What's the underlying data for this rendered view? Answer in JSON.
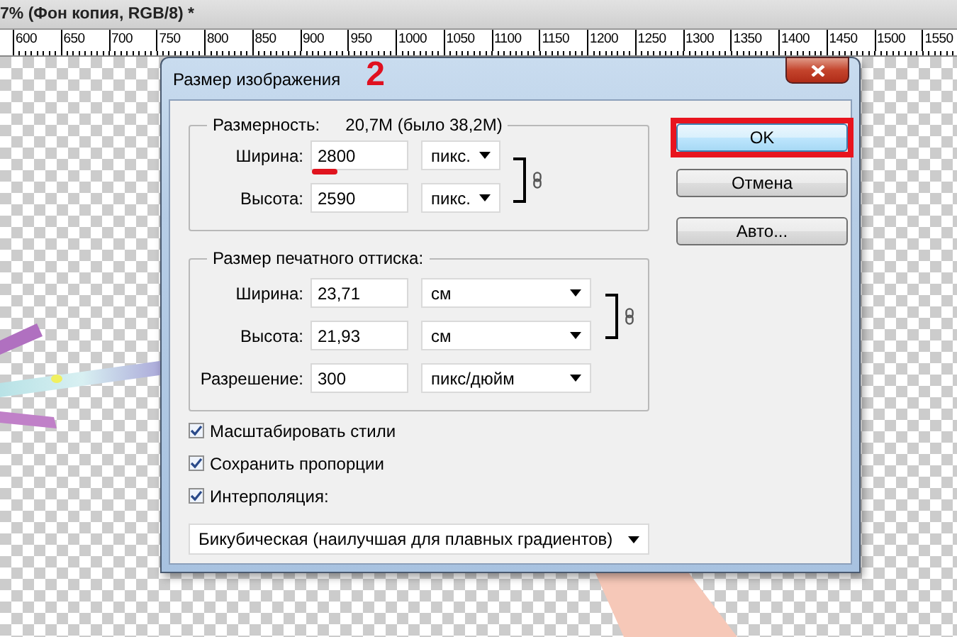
{
  "document_tab": {
    "title": "7% (Фон копия, RGB/8) *"
  },
  "ruler": {
    "labels": [
      "600",
      "650",
      "700",
      "750",
      "800",
      "850",
      "900",
      "950",
      "1000",
      "1050",
      "1100",
      "1150",
      "1200",
      "1250",
      "1300",
      "1350",
      "1400",
      "1450",
      "1500",
      "1550"
    ]
  },
  "dialog": {
    "title": "Размер изображения",
    "annotation": "2",
    "pixel_dimensions": {
      "label": "Размерность:",
      "value": "20,7M (было 38,2M)",
      "linked": true,
      "fields": [
        {
          "label": "Ширина:",
          "value": "2800",
          "unit": "пикс.",
          "marked": true
        },
        {
          "label": "Высота:",
          "value": "2590",
          "unit": "пикс.",
          "marked": false
        }
      ]
    },
    "document_size": {
      "label": "Размер печатного оттиска:",
      "linked": true,
      "fields": [
        {
          "label": "Ширина:",
          "value": "23,71",
          "unit": "см"
        },
        {
          "label": "Высота:",
          "value": "21,93",
          "unit": "см"
        },
        {
          "label": "Разрешение:",
          "value": "300",
          "unit": "пикс/дюйм"
        }
      ]
    },
    "options": [
      {
        "label": "Масштабировать стили",
        "checked": true
      },
      {
        "label": "Сохранить пропорции",
        "checked": true
      },
      {
        "label": "Интерполяция:",
        "checked": true
      }
    ],
    "resample": "Бикубическая (наилучшая для плавных градиентов)",
    "buttons": [
      {
        "label": "OK",
        "default": true,
        "highlighted": true
      },
      {
        "label": "Отмена",
        "default": false,
        "highlighted": false
      },
      {
        "label": "Авто...",
        "default": false,
        "highlighted": false
      }
    ]
  }
}
